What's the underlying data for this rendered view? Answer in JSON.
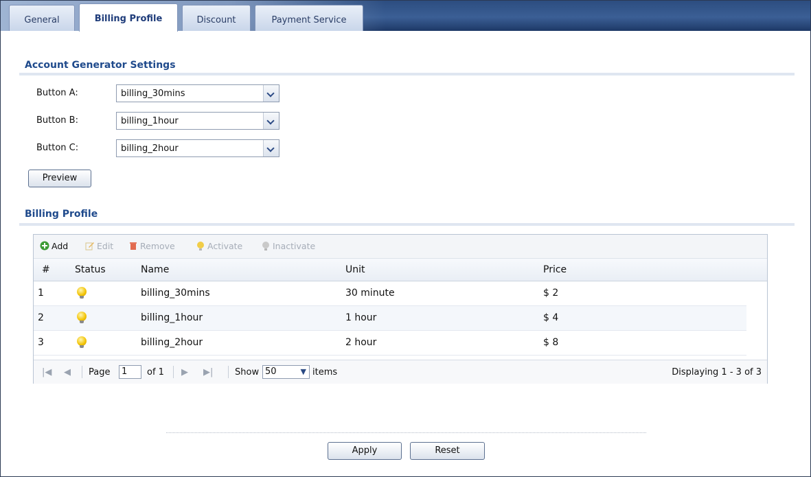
{
  "tabs": [
    "General",
    "Billing Profile",
    "Discount",
    "Payment Service"
  ],
  "account_generator": {
    "title": "Account Generator Settings",
    "buttons": [
      {
        "label": "Button A:",
        "value": "billing_30mins"
      },
      {
        "label": "Button B:",
        "value": "billing_1hour"
      },
      {
        "label": "Button C:",
        "value": "billing_2hour"
      }
    ],
    "preview_label": "Preview"
  },
  "billing_profile": {
    "title": "Billing Profile",
    "toolbar": {
      "add": "Add",
      "edit": "Edit",
      "remove": "Remove",
      "activate": "Activate",
      "inactivate": "Inactivate"
    },
    "columns": [
      "#",
      "Status",
      "Name",
      "Unit",
      "Price"
    ],
    "rows": [
      {
        "num": "1",
        "name": "billing_30mins",
        "unit": "30 minute",
        "price": "$ 2"
      },
      {
        "num": "2",
        "name": "billing_1hour",
        "unit": "1 hour",
        "price": "$ 4"
      },
      {
        "num": "3",
        "name": "billing_2hour",
        "unit": "2 hour",
        "price": "$ 8"
      }
    ],
    "pager": {
      "page_label": "Page",
      "page_value": "1",
      "of_label": "of 1",
      "show_label": "Show",
      "show_value": "50",
      "items_label": "items",
      "displaying": "Displaying 1 - 3 of 3"
    }
  },
  "footer": {
    "apply_label": "Apply",
    "reset_label": "Reset"
  },
  "colors": {
    "accent": "#1f4a8c",
    "tab_bar": "#2c4d80",
    "bulb": "#f2c200"
  }
}
